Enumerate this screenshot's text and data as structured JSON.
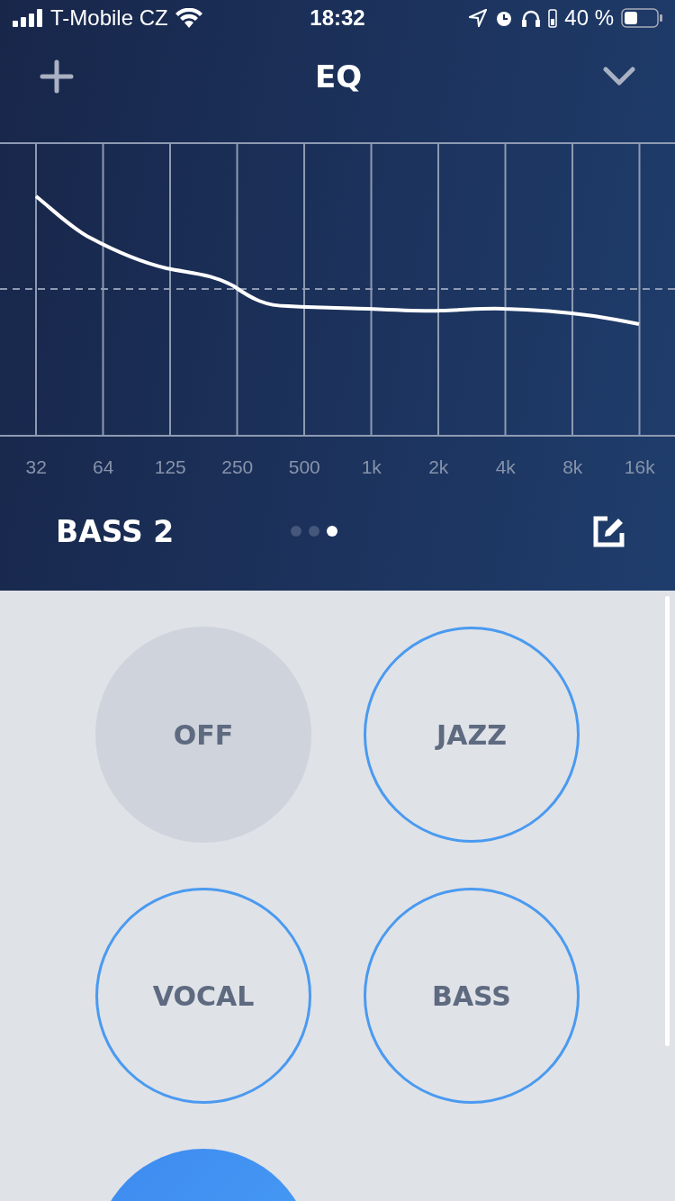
{
  "status_bar": {
    "carrier": "T-Mobile CZ",
    "time": "18:32",
    "battery": "40 %"
  },
  "header": {
    "title": "EQ"
  },
  "eq_chart": {
    "bands": [
      "32",
      "64",
      "125",
      "250",
      "500",
      "1k",
      "2k",
      "4k",
      "8k",
      "16k"
    ]
  },
  "preset_bar": {
    "name": "BASS 2",
    "pages": [
      {
        "selected": false
      },
      {
        "selected": false
      },
      {
        "selected": true
      }
    ]
  },
  "presets": [
    {
      "label": "OFF",
      "kind": "off",
      "selected": false
    },
    {
      "label": "JAZZ",
      "kind": "preset",
      "selected": false
    },
    {
      "label": "VOCAL",
      "kind": "preset",
      "selected": false
    },
    {
      "label": "BASS",
      "kind": "preset",
      "selected": false
    },
    {
      "kind": "preset",
      "selected": true
    }
  ]
}
